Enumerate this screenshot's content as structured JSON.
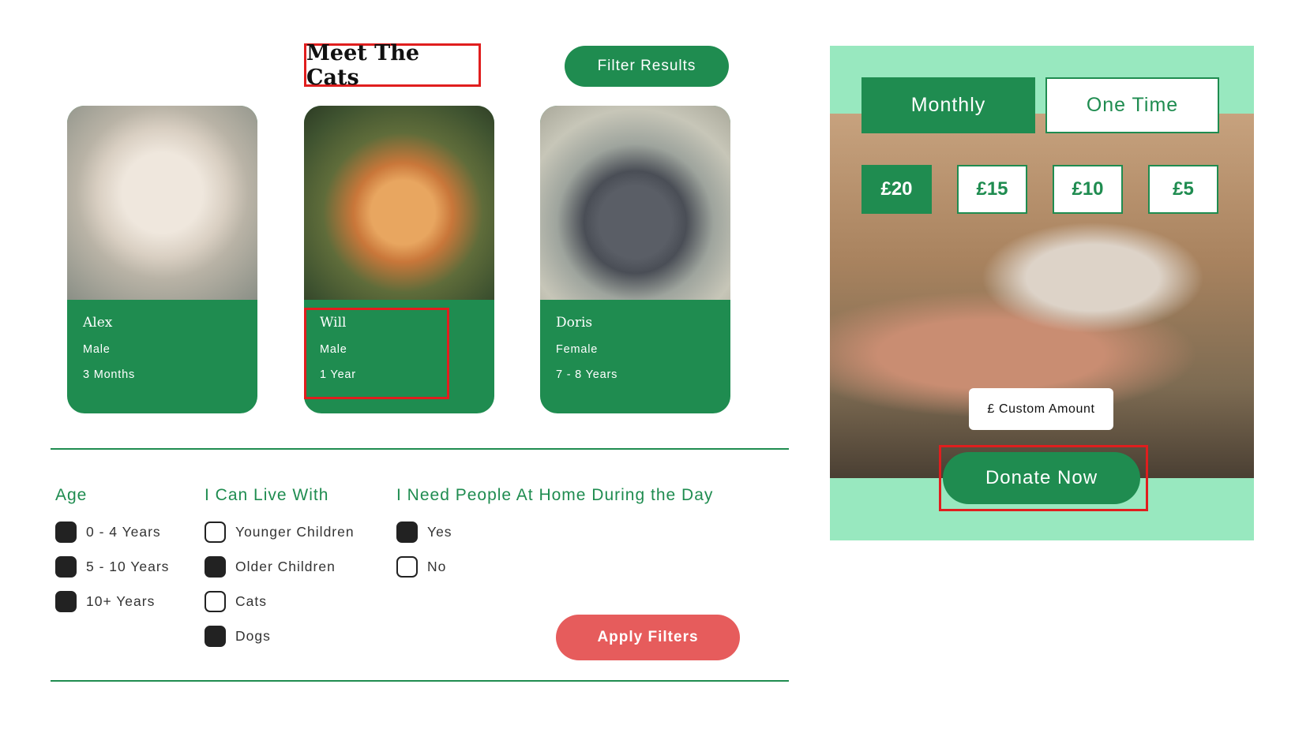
{
  "header": {
    "title": "Meet The Cats",
    "filter_results_label": "Filter Results"
  },
  "cats": [
    {
      "name": "Alex",
      "gender": "Male",
      "age": "3 Months"
    },
    {
      "name": "Will",
      "gender": "Male",
      "age": "1 Year"
    },
    {
      "name": "Doris",
      "gender": "Female",
      "age": "7 - 8 Years"
    }
  ],
  "filters": {
    "age": {
      "heading": "Age",
      "options": [
        {
          "label": "0 - 4 Years",
          "checked": true
        },
        {
          "label": "5 - 10 Years",
          "checked": true
        },
        {
          "label": "10+ Years",
          "checked": true
        }
      ]
    },
    "live_with": {
      "heading": "I Can Live With",
      "options": [
        {
          "label": "Younger Children",
          "checked": false
        },
        {
          "label": "Older Children",
          "checked": true
        },
        {
          "label": "Cats",
          "checked": false
        },
        {
          "label": "Dogs",
          "checked": true
        }
      ]
    },
    "people_home": {
      "heading": "I Need People At Home During the Day",
      "options": [
        {
          "label": "Yes",
          "checked": true
        },
        {
          "label": "No",
          "checked": false
        }
      ]
    },
    "apply_label": "Apply Filters"
  },
  "donate": {
    "frequency_tabs": [
      {
        "label": "Monthly",
        "selected": true
      },
      {
        "label": "One Time",
        "selected": false
      }
    ],
    "amounts": [
      {
        "label": "£20",
        "selected": true
      },
      {
        "label": "£15",
        "selected": false
      },
      {
        "label": "£10",
        "selected": false
      },
      {
        "label": "£5",
        "selected": false
      }
    ],
    "custom_placeholder": "£ Custom Amount",
    "donate_label": "Donate Now"
  },
  "colors": {
    "brand_green": "#1f8c50",
    "panel_mint": "#98e8bf",
    "apply_coral": "#e65c5c",
    "highlight_red": "#e01e1e"
  }
}
